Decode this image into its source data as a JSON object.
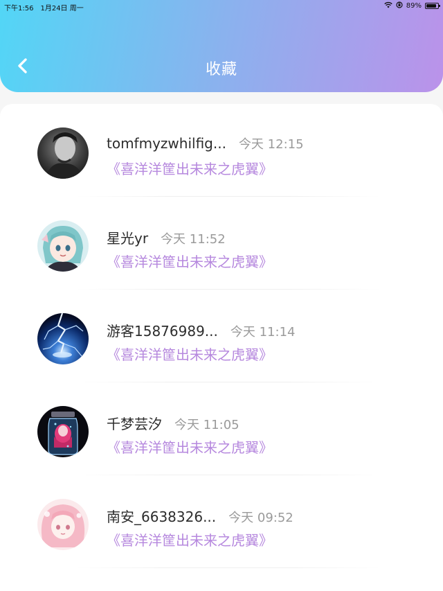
{
  "status_bar": {
    "time": "下午1:56",
    "date": "1月24日 周一",
    "battery_text": "89%",
    "battery_level": 0.89,
    "icons": [
      "wifi-icon",
      "orientation-lock-icon",
      "battery-icon"
    ]
  },
  "header": {
    "title": "收藏",
    "back_icon": "chevron-left-icon",
    "gradient_colors": [
      "#52d6f6",
      "#8ab2ee",
      "#bb92ea"
    ]
  },
  "favorites": [
    {
      "username": "tomfmyzwhilfig...",
      "time": "今天 12:15",
      "work": "《喜洋洋筐出未来之虎翼》",
      "avatar": "dark-portrait"
    },
    {
      "username": "星光yr",
      "time": "今天 11:52",
      "work": "《喜洋洋筐出未来之虎翼》",
      "avatar": "anime-cyan"
    },
    {
      "username": "游客15876989...",
      "time": "今天 11:14",
      "work": "《喜洋洋筐出未来之虎翼》",
      "avatar": "lightning"
    },
    {
      "username": "千梦芸汐",
      "time": "今天 11:05",
      "work": "《喜洋洋筐出未来之虎翼》",
      "avatar": "bottle-girl"
    },
    {
      "username": "南安_6638326...",
      "time": "今天 09:52",
      "work": "《喜洋洋筐出未来之虎翼》",
      "avatar": "pink-anime"
    }
  ],
  "colors": {
    "title_link": "#b688de",
    "username": "#2c2c2c",
    "time": "#9a9a9a"
  }
}
